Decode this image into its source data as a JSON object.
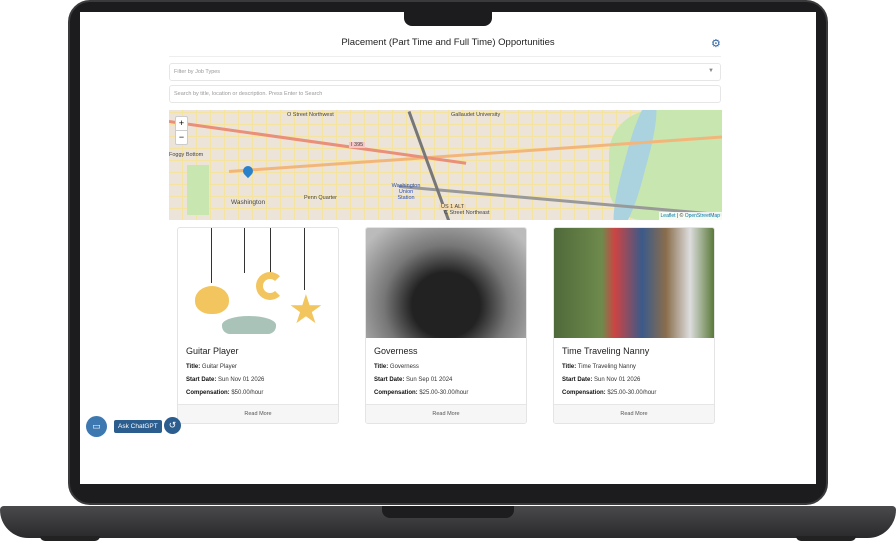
{
  "header": {
    "title": "Placement (Part Time and Full Time) Opportunities",
    "settings_icon": "gear-icon"
  },
  "filters": {
    "job_types_placeholder": "Filter by Job Types",
    "search_placeholder": "Search by title, location or description. Press Enter to Search"
  },
  "map": {
    "zoom_in": "+",
    "zoom_out": "−",
    "labels": [
      "Washington",
      "Penn Quarter",
      "Washington Union Station",
      "I 395",
      "US 1 ALT",
      "Foggy Bottom",
      "O Street Northwest",
      "Gallaudet University",
      "C Street Northeast"
    ],
    "attribution_leaflet": "Leaflet",
    "attribution_sep": " | © ",
    "attribution_osm": "OpenStreetMap"
  },
  "jobs": [
    {
      "heading": "Guitar Player",
      "title_label": "Title:",
      "title": "Guitar Player",
      "start_label": "Start Date:",
      "start": "Sun Nov 01 2026",
      "comp_label": "Compensation:",
      "comp": "$50.00/hour",
      "read_more": "Read More"
    },
    {
      "heading": "Governess",
      "title_label": "Title:",
      "title": "Governess",
      "start_label": "Start Date:",
      "start": "Sun Sep 01 2024",
      "comp_label": "Compensation:",
      "comp": "$25.00-30.00/hour",
      "read_more": "Read More"
    },
    {
      "heading": "Time Traveling Nanny",
      "title_label": "Title:",
      "title": "Time Traveling Nanny",
      "start_label": "Start Date:",
      "start": "Sun Nov 01 2026",
      "comp_label": "Compensation:",
      "comp": "$25.00-30.00/hour",
      "read_more": "Read More"
    }
  ],
  "chat": {
    "ask_label": "Ask ChatGPT"
  },
  "colors": {
    "accent": "#2c5d8f",
    "pin": "#2a81cb"
  }
}
